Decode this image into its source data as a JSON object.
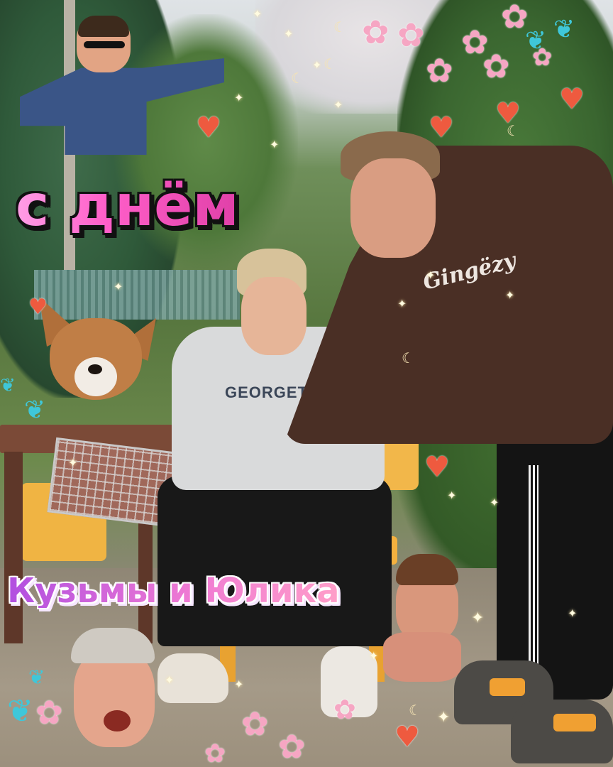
{
  "title_top": "с днём",
  "title_bottom": "Кузьмы и Юлика",
  "shirt_print": "GEORGETOWN",
  "hoodie_print": "Gingëzy",
  "colors": {
    "title_top_fill": "#ff6fd0",
    "title_top_outline": "#111111",
    "title_bottom_fill": "#e468d8",
    "title_bottom_outline": "#ffffff",
    "heart": "#ee5a3f",
    "chair": "#f4b13f",
    "hoodie": "#4a2f25",
    "sweatshirt": "#d9dadb"
  },
  "decorations": {
    "heart_icon": "heart-icon",
    "star_icon": "sparkle-star-icon",
    "moon_icon": "crescent-moon-icon",
    "flower_icon": "cherry-blossom-icon",
    "butterfly_icon": "butterfly-icon",
    "heart_glyph": "♥",
    "star_glyph": "✦",
    "moon_glyph": "☾",
    "flower_glyph": "✿",
    "butterfly_glyph": "❦"
  }
}
